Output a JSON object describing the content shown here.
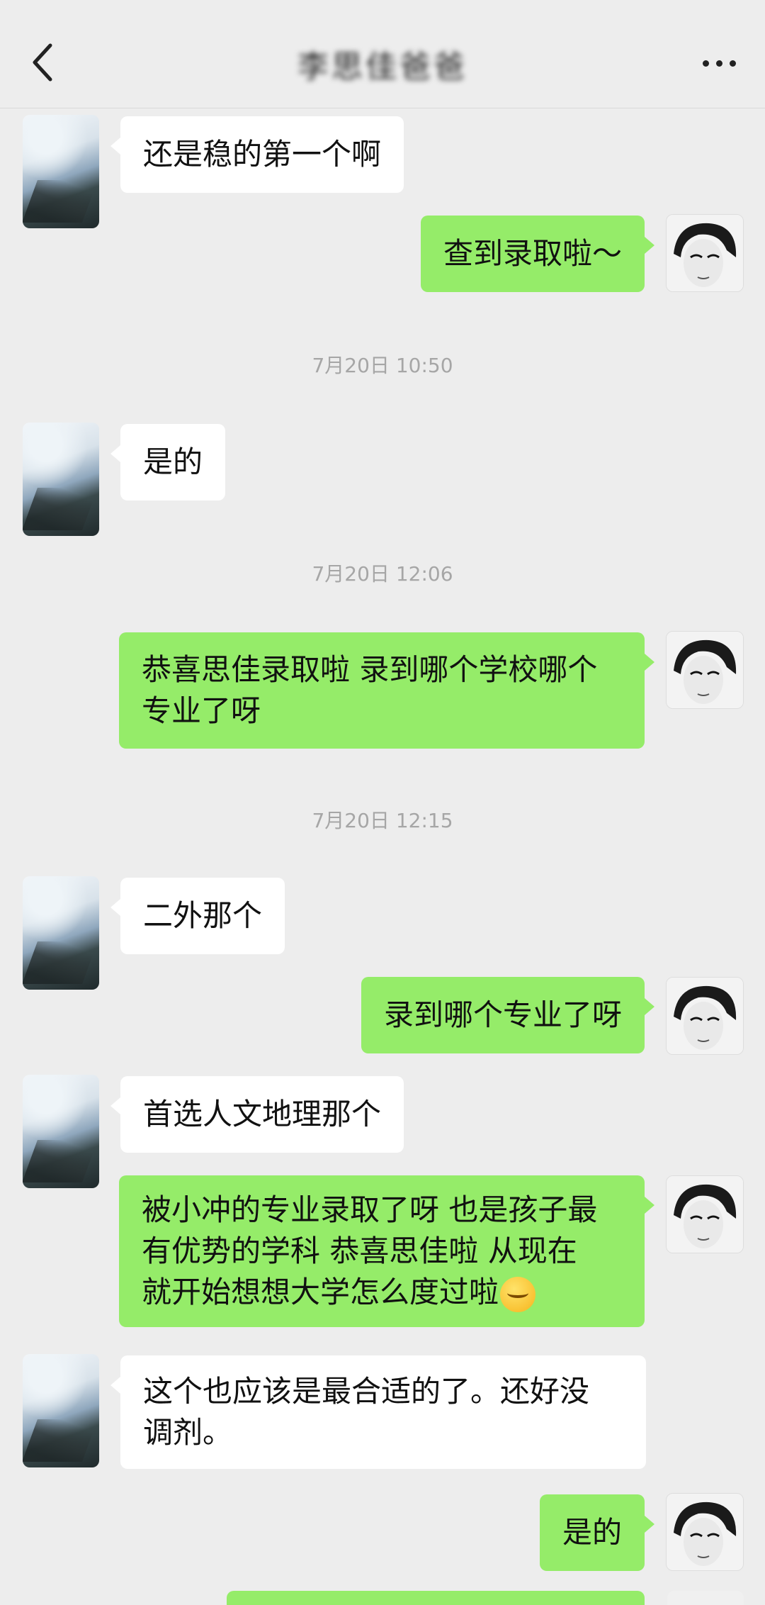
{
  "header": {
    "back_icon": "chevron-left-icon",
    "title": "李思佳爸爸",
    "more_icon": "more-dots-icon"
  },
  "messages": [
    {
      "side": "left",
      "text": "还是稳的第一个啊"
    },
    {
      "side": "right",
      "text": "查到录取啦～"
    },
    {
      "type": "time",
      "text": "7月20日 10:50"
    },
    {
      "side": "left",
      "text": "是的"
    },
    {
      "type": "time",
      "text": "7月20日 12:06"
    },
    {
      "side": "right",
      "line1": "恭喜思佳录取啦 录到哪个学校哪个",
      "line2": "专业了呀"
    },
    {
      "type": "time",
      "text": "7月20日 12:15"
    },
    {
      "side": "left",
      "text": "二外那个"
    },
    {
      "side": "right",
      "text": "录到哪个专业了呀"
    },
    {
      "side": "left",
      "text": "首选人文地理那个"
    },
    {
      "side": "right",
      "line1": "被小冲的专业录取了呀 也是孩子最",
      "line2": "有优势的学科 恭喜思佳啦  从现在",
      "line3": "就开始想想大学怎么度过啦",
      "emoji": "grin-emoji"
    },
    {
      "side": "left",
      "line1": "这个也应该是最合适的了。还好没",
      "line2": "调剂。"
    },
    {
      "side": "right",
      "text": "是的"
    }
  ],
  "colors": {
    "background": "#ededed",
    "bubble_self": "#95ec69",
    "bubble_other": "#ffffff",
    "timestamp": "#a6a6a6"
  }
}
